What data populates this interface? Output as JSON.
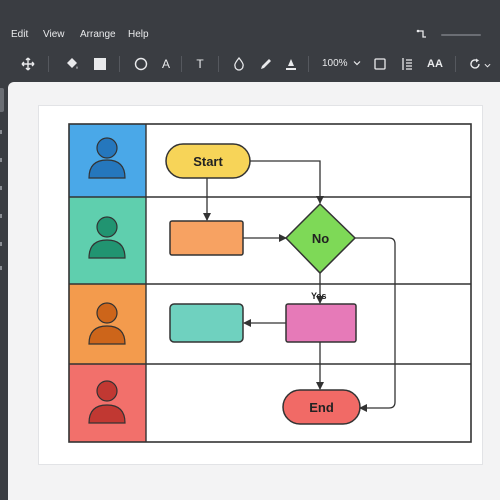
{
  "menu": {
    "edit": "Edit",
    "view": "View",
    "arrange": "Arrange",
    "help": "Help"
  },
  "toolbar": {
    "zoom": "100%",
    "text_tool": "A",
    "type_tool": "T",
    "font_size_tool": "AA",
    "icons": [
      "move-icon",
      "fill-bucket-icon",
      "square-icon",
      "circle-icon",
      "text-icon",
      "type-icon",
      "drop-icon",
      "pen-icon",
      "highlighter-icon",
      "zoom-chevron-icon",
      "frame-icon",
      "list-icon",
      "font-size-icon",
      "rotate-icon"
    ]
  },
  "lanes": [
    {
      "color": "#4aa8e8",
      "icon": "person-icon",
      "icon_color": "#1f6fb5"
    },
    {
      "color": "#5fcfae",
      "icon": "person-icon",
      "icon_color": "#168a66"
    },
    {
      "color": "#f39b4d",
      "icon": "person-icon",
      "icon_color": "#c65c12"
    },
    {
      "color": "#f2706b",
      "icon": "person-icon",
      "icon_color": "#b82e28"
    }
  ],
  "shapes": {
    "start": {
      "label": "Start",
      "color": "#f7d458"
    },
    "process1": {
      "label": "",
      "color": "#f7a262"
    },
    "decision": {
      "label": "No",
      "color": "#7ed957"
    },
    "process2": {
      "label": "",
      "color": "#e67ab8"
    },
    "process3": {
      "label": "",
      "color": "#6fd1bf"
    },
    "end": {
      "label": "End",
      "color": "#f16a66"
    }
  },
  "yes_label": "Yes"
}
